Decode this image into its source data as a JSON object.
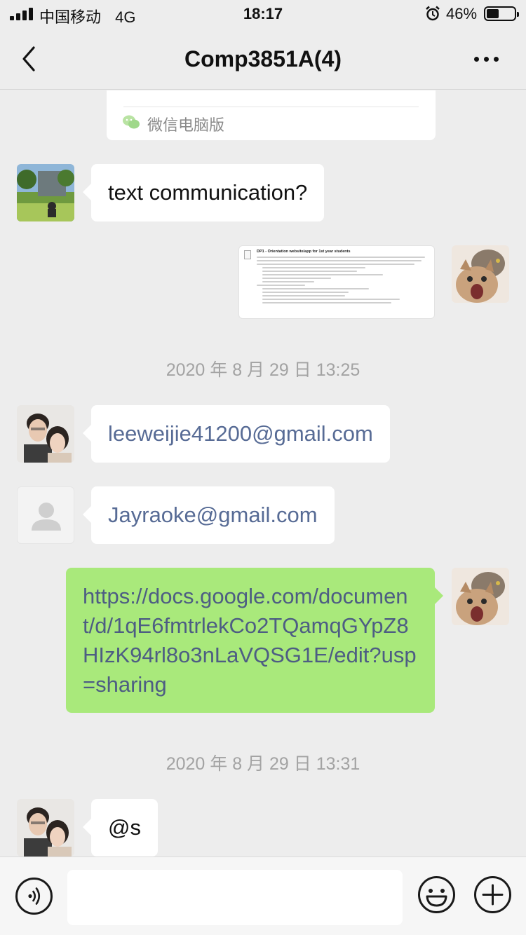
{
  "status_bar": {
    "carrier": "中国移动",
    "network": "4G",
    "time": "18:17",
    "battery_percent": "46%",
    "battery_level": 0.46,
    "icons": [
      "signal-icon",
      "alarm-icon",
      "battery-icon"
    ]
  },
  "nav": {
    "title": "Comp3851A(4)",
    "back_icon": "chevron-left-icon",
    "more_icon": "more-dots-icon"
  },
  "chat": {
    "card_source": "微信电脑版",
    "messages": [
      {
        "side": "left",
        "text": "text communication?"
      },
      {
        "side": "right",
        "type": "document-image",
        "doc_title": "DP1 - Orientation website/app for 1st year students"
      },
      {
        "type": "timestamp",
        "text": "2020 年 8 月 29 日 13:25"
      },
      {
        "side": "left",
        "text": "leeweijie41200@gmail.com"
      },
      {
        "side": "left",
        "text": "Jayraoke@gmail.com"
      },
      {
        "side": "right",
        "text": "https://docs.google.com/document/d/1qE6fmtrlekCo2TQamqGYpZ8HIzK94rl8o3nLaVQSG1E/edit?usp=sharing"
      },
      {
        "type": "timestamp",
        "text": "2020 年 8 月 29 日 13:31"
      },
      {
        "side": "left",
        "text": "@s"
      }
    ]
  },
  "colors": {
    "background": "#ededed",
    "bubble_self": "#a9e97b",
    "bubble_other": "#ffffff",
    "link": "#576b95",
    "timestamp": "#a3a3a3"
  },
  "input_bar": {
    "placeholder": "",
    "icons": [
      "voice-icon",
      "emoji-icon",
      "add-icon"
    ]
  }
}
